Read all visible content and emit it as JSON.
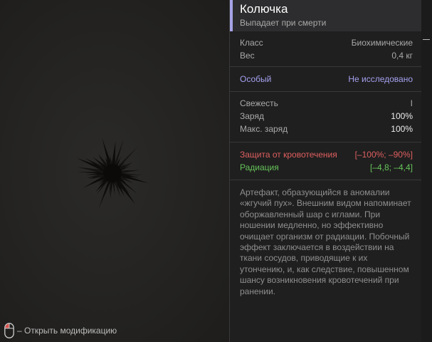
{
  "item": {
    "title": "Колючка",
    "subtitle": "Выпадает при смерти"
  },
  "basic": [
    {
      "key": "Класс",
      "value": "Биохимические"
    },
    {
      "key": "Вес",
      "value": "0,4 кг"
    }
  ],
  "special": {
    "key": "Особый",
    "value": "Не исследовано"
  },
  "status": [
    {
      "key": "Свежесть",
      "value": "I"
    },
    {
      "key": "Заряд",
      "value": "100%"
    },
    {
      "key": "Макс. заряд",
      "value": "100%"
    }
  ],
  "effects": [
    {
      "key": "Защита от кровотечения",
      "value": "[–100%; –90%]",
      "color": "#df5f5f"
    },
    {
      "key": "Радиация",
      "value": "[–4,8; –4,4]",
      "color": "#66c35a"
    }
  ],
  "description": "Артефакт, образующийся в аномалии «жгучий пух». Внешним видом напоминает оборжавленный шар с иглами. При ношении медленно, но эффективно очищает организм от радиации. Побочный эффект заключается в воздействии на ткани сосудов, приводящие к их утончению, и, как следствие, повышенном шансу возникновения кровотечений при ранении.",
  "hint": {
    "icon": "mouse-icon",
    "text": "– Открыть модификацию"
  }
}
